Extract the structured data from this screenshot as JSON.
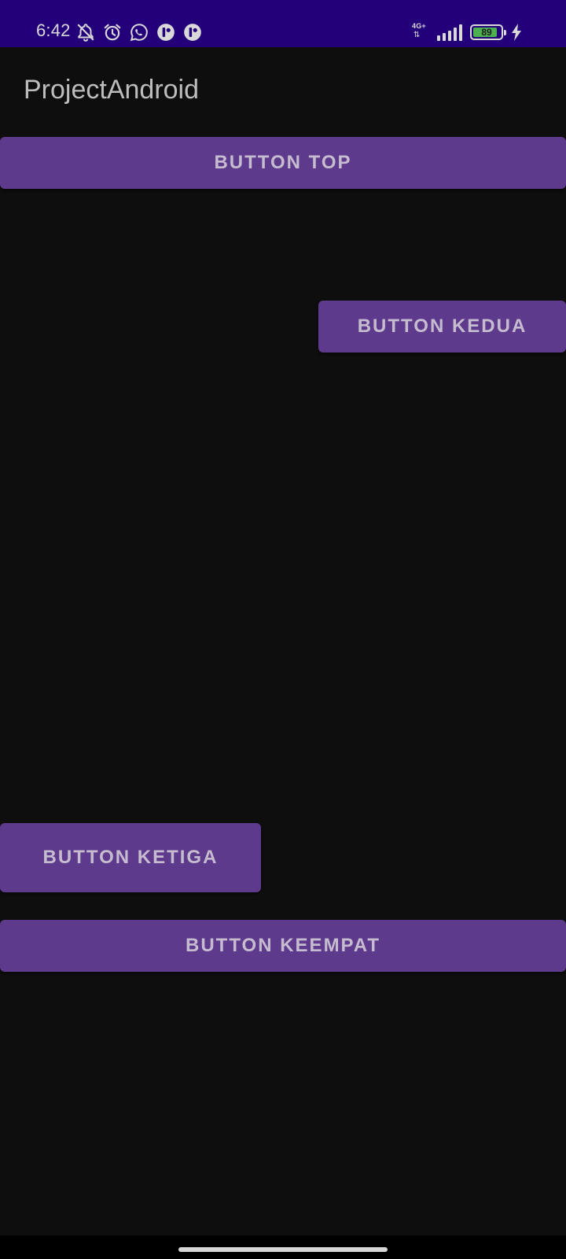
{
  "status_bar": {
    "time": "6:42",
    "left_icons": [
      "notifications-off-icon",
      "alarm-icon",
      "whatsapp-icon",
      "app-notification-icon",
      "app-notification-icon"
    ],
    "network_type": "4G+",
    "signal_level": 5,
    "battery_percent": "89",
    "charging": true
  },
  "app_bar": {
    "title": "ProjectAndroid"
  },
  "buttons": {
    "top": "BUTTON TOP",
    "kedua": "BUTTON KEDUA",
    "ketiga": "BUTTON KETIGA",
    "keempat": "BUTTON KEEMPAT"
  },
  "colors": {
    "status_bar": "#23007a",
    "background": "#0e0e0e",
    "button": "#5e3a8c",
    "button_text": "#c6bccf",
    "battery_fill": "#4caf50"
  }
}
